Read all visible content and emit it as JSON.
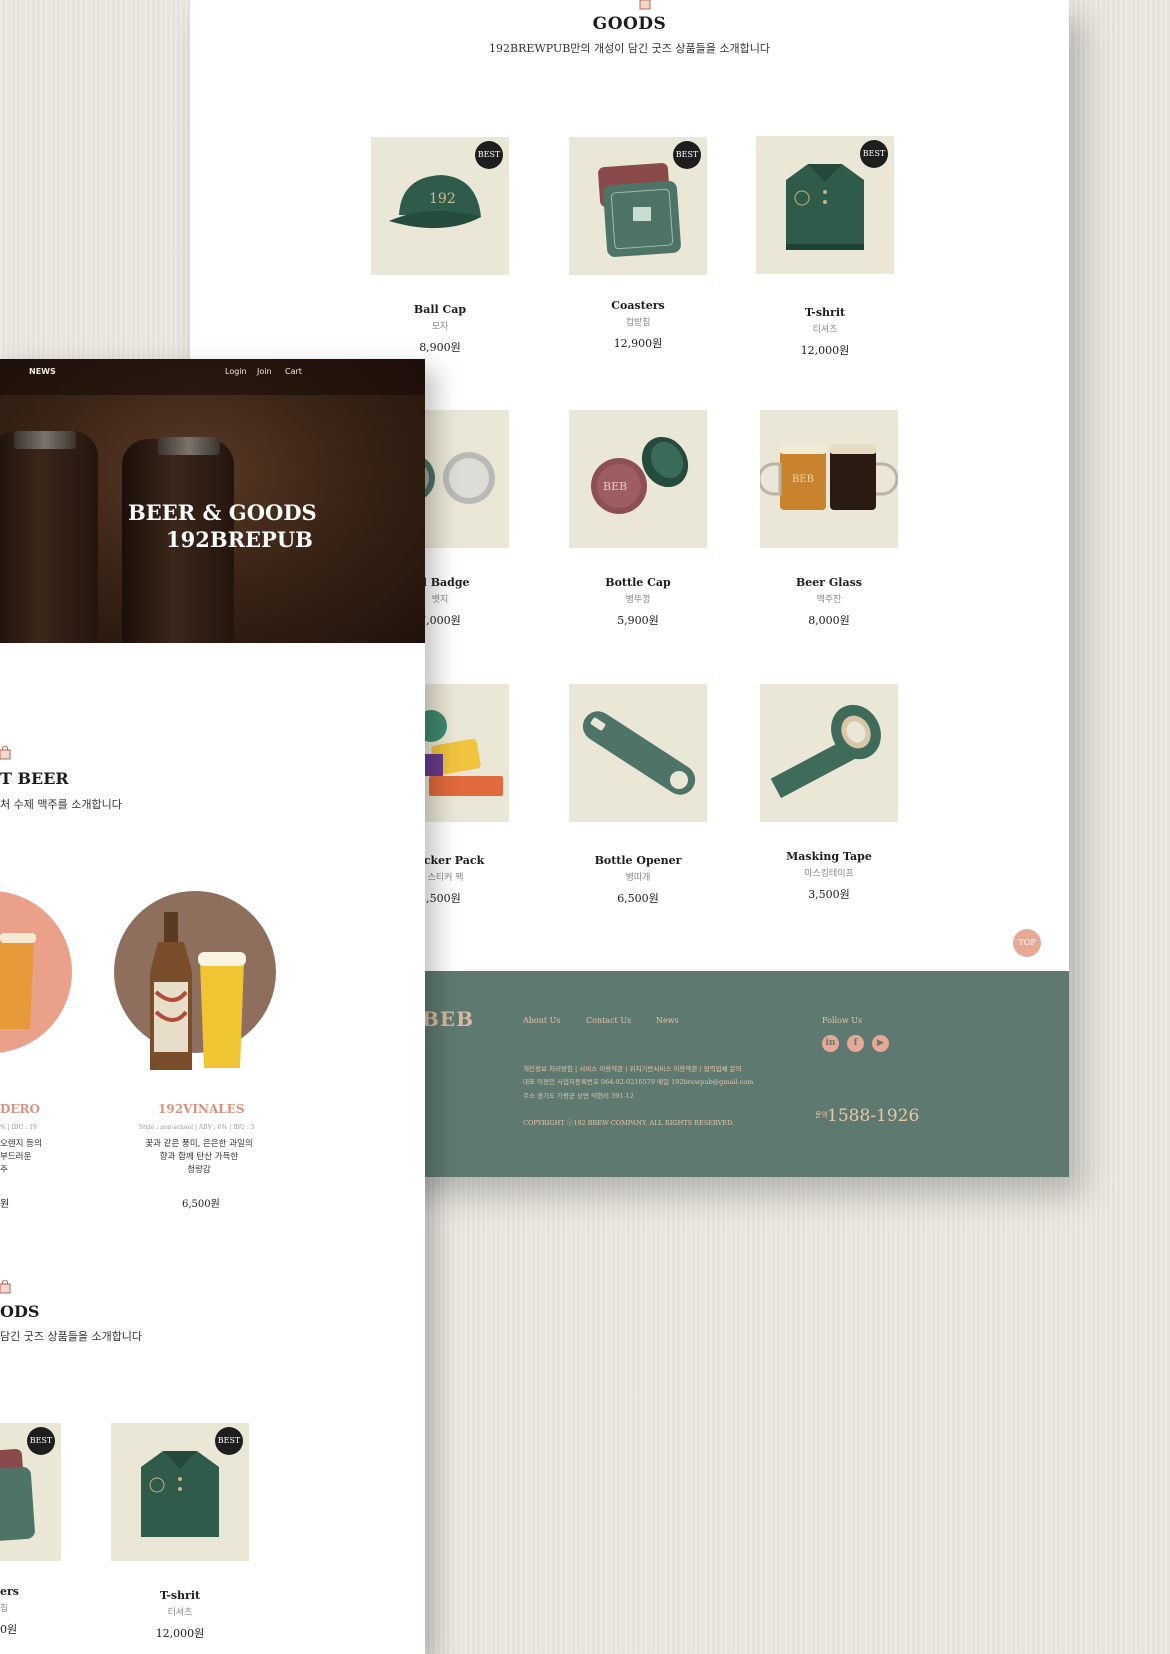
{
  "goods_section": {
    "title": "GOODS",
    "subtitle": "192BREWPUB만의 개성이 담긴 굿즈 상품들을 소개합니다"
  },
  "products": [
    {
      "name": "Ball Cap",
      "kr": "모자",
      "price": "8,900원",
      "badge": "BEST",
      "icon": "ball-cap"
    },
    {
      "name": "Coasters",
      "kr": "컵받침",
      "price": "12,900원",
      "badge": "BEST",
      "icon": "coasters"
    },
    {
      "name": "T-shrit",
      "kr": "티셔츠",
      "price": "12,000원",
      "badge": "BEST",
      "icon": "t-shirt"
    },
    {
      "name": "tal Badge",
      "kr": "뱃지",
      "price": "7,000원",
      "icon": "metal-badge"
    },
    {
      "name": "Bottle Cap",
      "kr": "병뚜껑",
      "price": "5,900원",
      "icon": "bottle-cap"
    },
    {
      "name": "Beer Glass",
      "kr": "맥주잔",
      "price": "8,000원",
      "icon": "beer-glass"
    },
    {
      "name": "e Sticker Pack",
      "kr": "커 스티커 팩",
      "price": "2,500원",
      "icon": "sticker-pack"
    },
    {
      "name": "Bottle Opener",
      "kr": "병따개",
      "price": "6,500원",
      "icon": "bottle-opener"
    },
    {
      "name": "Masking Tape",
      "kr": "마스킹테이프",
      "price": "3,500원",
      "icon": "masking-tape"
    }
  ],
  "top_button": "TOP",
  "footer": {
    "logo": "BEB",
    "links": [
      "About Us",
      "Contact Us",
      "News"
    ],
    "follow_label": "Follow Us",
    "sns": [
      "in",
      "f",
      "▶"
    ],
    "info_line1": "개인정보 처리방침 | 서비스 이용약관 | 위치기반서비스 이용약관 | 협력업체 문의",
    "info_line2": "대표 이정민   사업자등록번호 064-92-0216579  메일 192brewpub@gmail.com",
    "info_line3": "주소  경기도 가평군 상면 덕현리 391-12",
    "copyright": "COPYRIGHT ⓒ192 BREW COMPANY. ALL RIGHTS RESERVED.",
    "phone_label": "문의",
    "phone": "1588-1926"
  },
  "front_page": {
    "nav": {
      "news": "NEWS",
      "login": "Login",
      "join": "Join",
      "cart": "Cart"
    },
    "hero_line1": "BEER & GOODS",
    "hero_line2": "192BREPUB",
    "beer_section_title": "T BEER",
    "beer_section_sub": "처 수제 맥주를 소개합니다",
    "beers": [
      {
        "name": "DERO",
        "spec": "% | IBU : 19",
        "desc_lines": [
          "오렌지 등의",
          "부드러운",
          "주"
        ],
        "price": "원"
      },
      {
        "name": "192VINALES",
        "spec": "Style : non-school | ABV : 6% | IBU : 3",
        "desc_lines": [
          "꽃과 같은 풍미, 은은한 과일의",
          "향과 함께 탄산 가득한",
          "청량감"
        ],
        "price": "6,500원"
      }
    ],
    "goods_title": "ODS",
    "goods_sub": "담긴 굿즈 상품들을 소개합니다",
    "goods_items": [
      {
        "name": "ers",
        "kr": "침",
        "price": "0원",
        "badge": "BEST"
      },
      {
        "name": "T-shrit",
        "kr": "티셔츠",
        "price": "12,000원",
        "badge": "BEST"
      }
    ]
  },
  "colors": {
    "footer_green": "#5e7a70",
    "accent_peach": "#e7a996",
    "product_bg": "#ebe7d6",
    "hero_brown": "#3b2416"
  }
}
